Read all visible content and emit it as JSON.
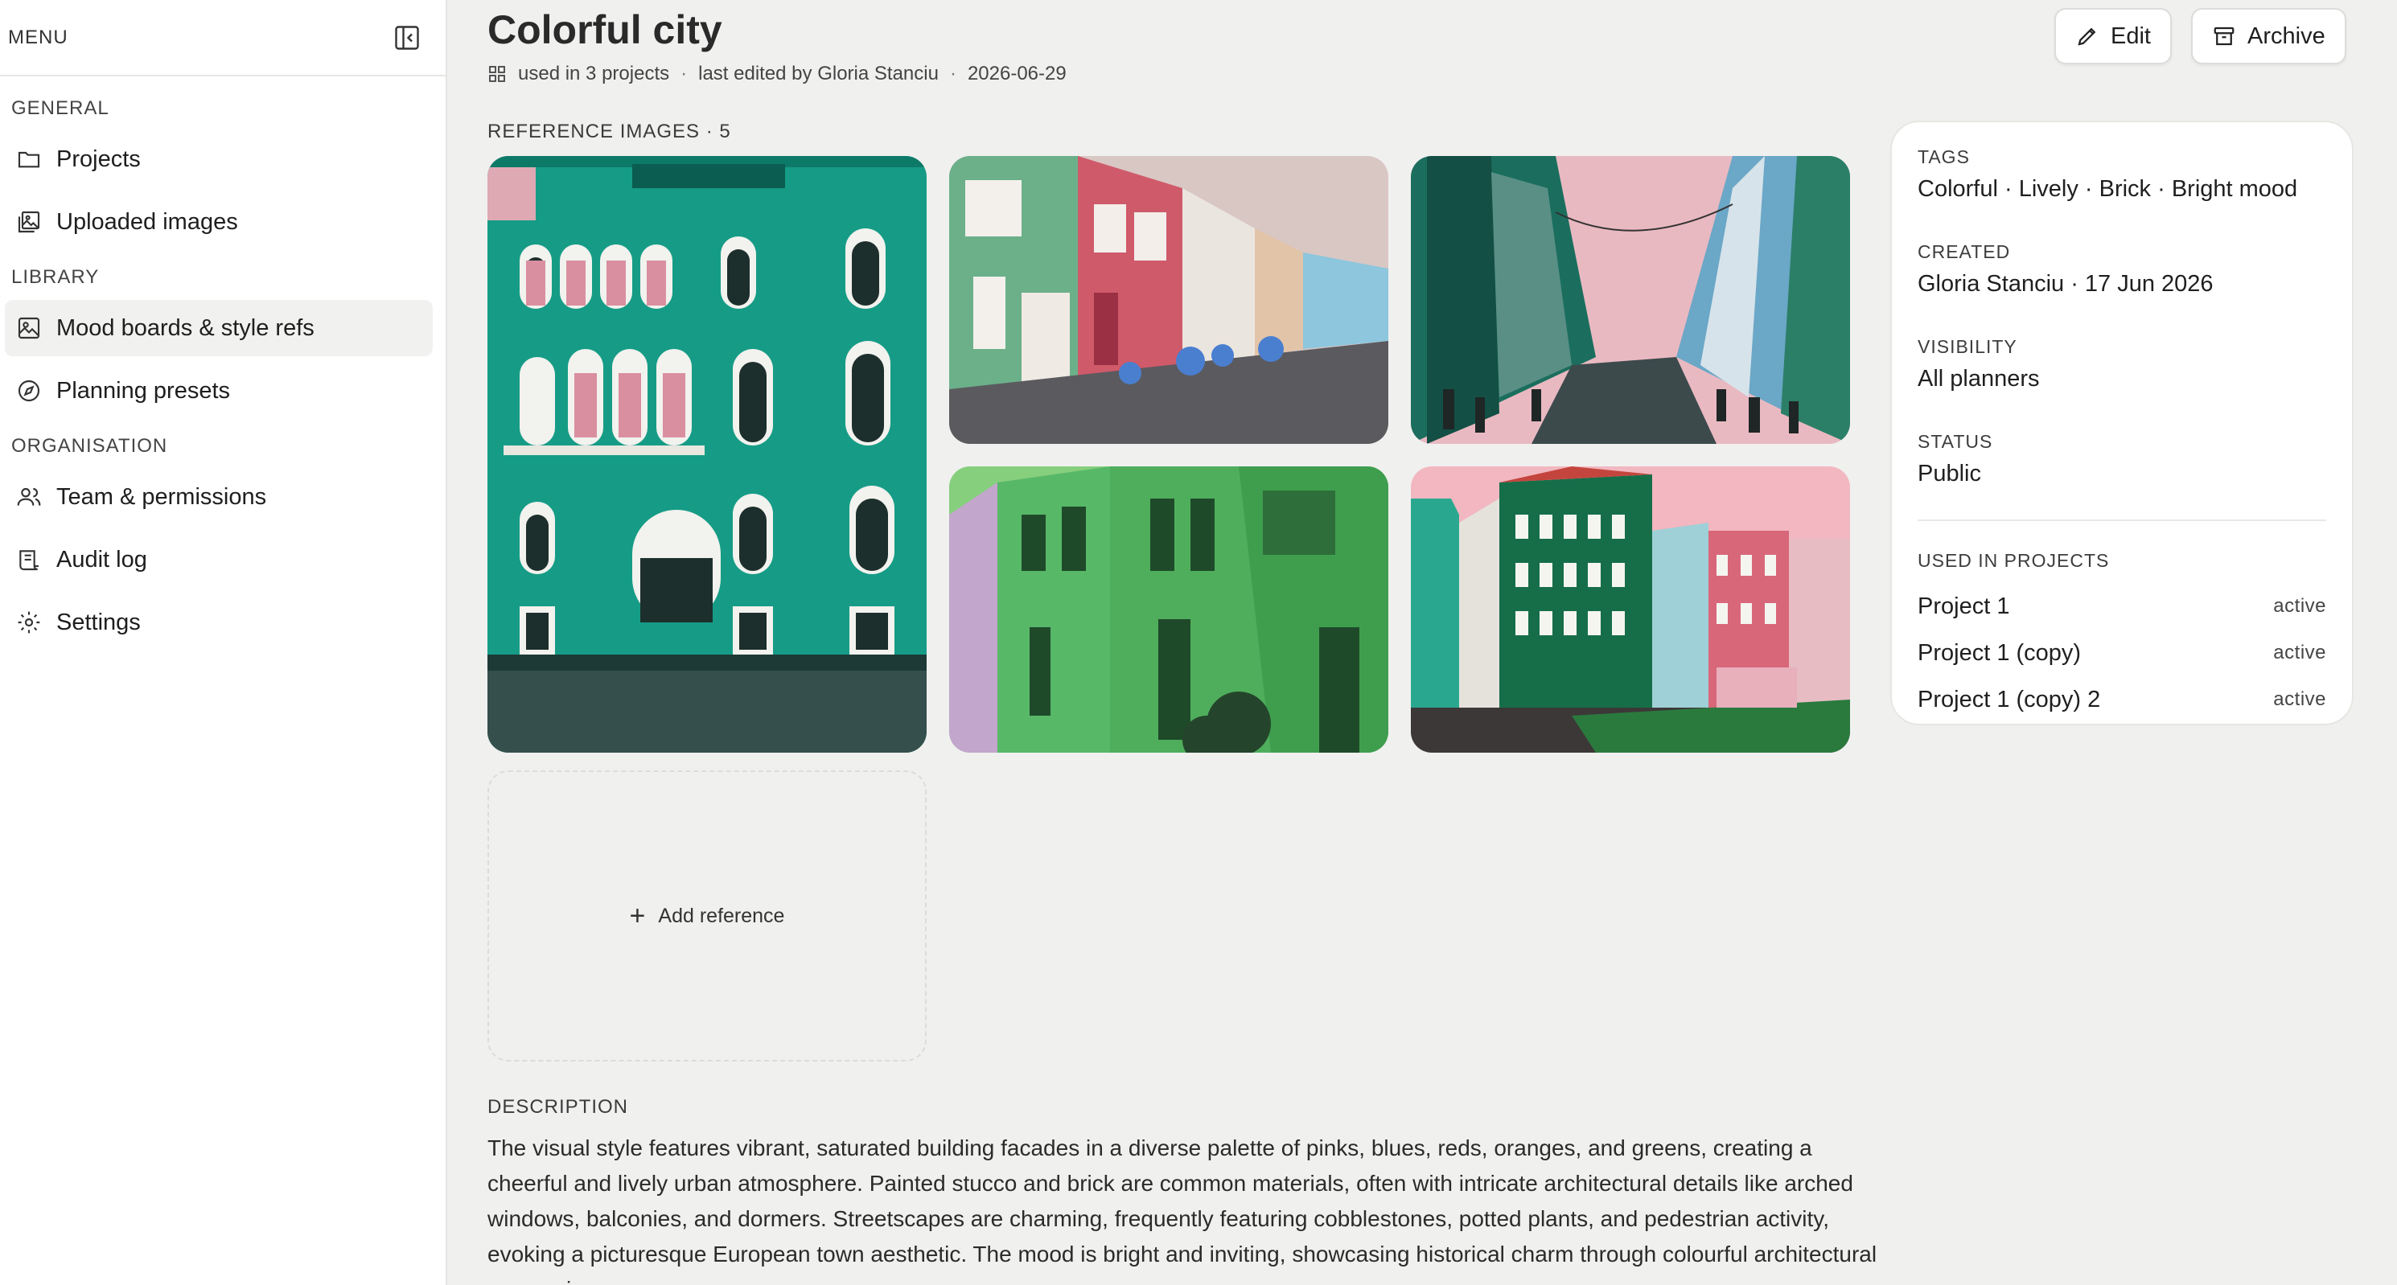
{
  "sidebar": {
    "menu_label": "MENU",
    "sections": [
      {
        "title": "GENERAL",
        "items": [
          {
            "label": "Projects",
            "icon": "folder-icon"
          },
          {
            "label": "Uploaded images",
            "icon": "images-icon"
          }
        ]
      },
      {
        "title": "LIBRARY",
        "items": [
          {
            "label": "Mood boards & style refs",
            "icon": "image-icon",
            "active": true
          },
          {
            "label": "Planning presets",
            "icon": "compass-icon"
          }
        ]
      },
      {
        "title": "ORGANISATION",
        "items": [
          {
            "label": "Team & permissions",
            "icon": "users-icon"
          },
          {
            "label": "Audit log",
            "icon": "scroll-icon"
          },
          {
            "label": "Settings",
            "icon": "gear-icon"
          }
        ]
      }
    ]
  },
  "header": {
    "title": "Colorful city",
    "meta": {
      "used_in": "used in 3 projects",
      "edited": "last edited by Gloria Stanciu",
      "date": "2026-06-29"
    },
    "edit_label": "Edit",
    "archive_label": "Archive"
  },
  "references": {
    "label": "REFERENCE IMAGES · 5",
    "add_label": "Add reference",
    "images": [
      {
        "name": "teal-venetian-facade",
        "palette": [
          "#169c86",
          "#0d7a68",
          "#dfa9b3"
        ]
      },
      {
        "name": "pastel-mews-street",
        "palette": [
          "#cf5a6a",
          "#6cb08a",
          "#d9c7c4"
        ]
      },
      {
        "name": "busy-colorful-street",
        "palette": [
          "#1b6e5e",
          "#e9b9c1",
          "#6ba7c7"
        ]
      },
      {
        "name": "green-alley",
        "palette": [
          "#57b868",
          "#86cf7d",
          "#c2a6cc"
        ]
      },
      {
        "name": "nyhavn-harbour",
        "palette": [
          "#166e49",
          "#d86779",
          "#9fd0d7"
        ]
      }
    ]
  },
  "details": {
    "tags_label": "TAGS",
    "tags": "Colorful · Lively · Brick · Bright mood",
    "created_label": "CREATED",
    "created": "Gloria Stanciu · 17 Jun 2026",
    "visibility_label": "VISIBILITY",
    "visibility": "All planners",
    "status_label": "STATUS",
    "status": "Public",
    "projects_label": "USED IN PROJECTS",
    "projects": [
      {
        "name": "Project 1",
        "state": "active"
      },
      {
        "name": "Project 1 (copy)",
        "state": "active"
      },
      {
        "name": "Project 1 (copy) 2",
        "state": "active"
      }
    ]
  },
  "description": {
    "label": "DESCRIPTION",
    "text": "The visual style features vibrant, saturated building facades in a diverse palette of pinks, blues, reds, oranges, and greens, creating a cheerful and lively urban atmosphere. Painted stucco and brick are common materials, often with intricate architectural details like arched windows, balconies, and dormers. Streetscapes are charming, frequently featuring cobblestones, potted plants, and pedestrian activity, evoking a picturesque European town aesthetic. The mood is bright and inviting, showcasing historical charm through colourful architectural expressions."
  }
}
